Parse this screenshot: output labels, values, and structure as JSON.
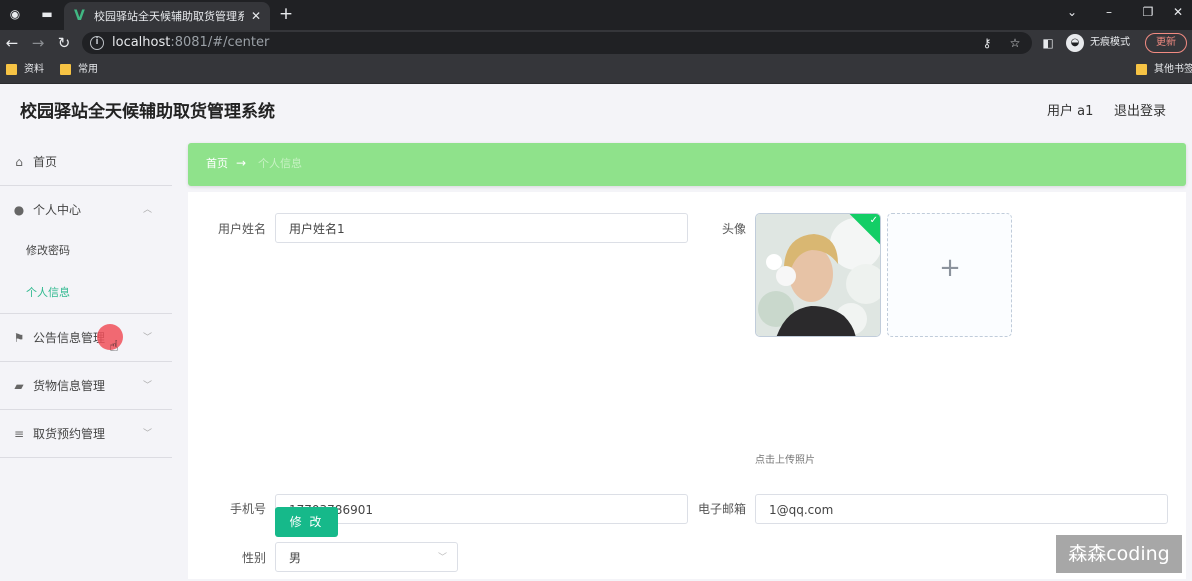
{
  "browser": {
    "tab_title": "校园驿站全天候辅助取货管理系",
    "tab_favicon": "V",
    "url_host": "localhost",
    "url_rest": ":8081/#/center",
    "profile_label": "无痕模式",
    "update_label": "更新",
    "bookmarks": [
      {
        "label": "资料"
      },
      {
        "label": "常用"
      },
      {
        "label": "其他书签"
      }
    ]
  },
  "header": {
    "title": "校园驿站全天候辅助取货管理系统",
    "user": "用户 a1",
    "logout": "退出登录"
  },
  "sidebar": {
    "home": "首页",
    "personal_center": "个人中心",
    "change_password": "修改密码",
    "personal_info": "个人信息",
    "notice_mgmt": "公告信息管理",
    "goods_mgmt": "货物信息管理",
    "pickup_mgmt": "取货预约管理"
  },
  "breadcrumb": {
    "home": "首页",
    "separator": "→",
    "current": "个人信息"
  },
  "form": {
    "username_label": "用户姓名",
    "username_value": "用户姓名1",
    "avatar_label": "头像",
    "upload_tip": "点击上传照片",
    "phone_label": "手机号",
    "phone_value": "17703786901",
    "email_label": "电子邮箱",
    "email_value": "1@qq.com",
    "gender_label": "性别",
    "gender_value": "男",
    "submit": "修 改"
  },
  "watermark": "森森coding",
  "colors": {
    "breadcrumb_bg": "#8fe28b",
    "active_menu": "#2fb98f",
    "primary_button": "#16b98a",
    "success_mark": "#13ce66"
  }
}
